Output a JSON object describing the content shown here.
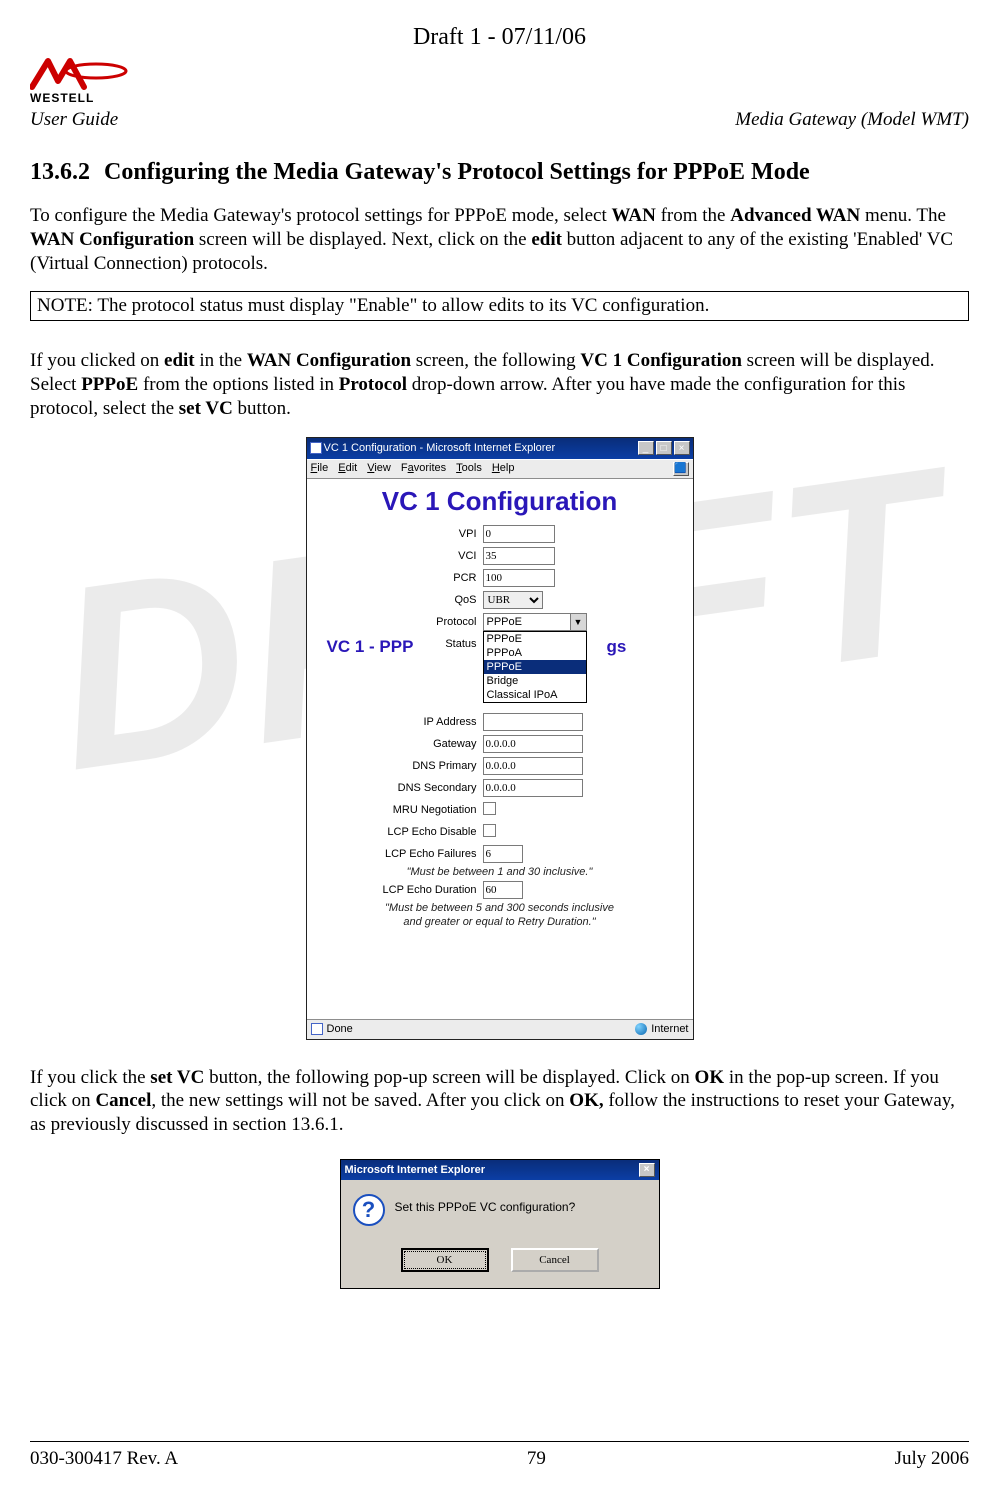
{
  "draft_header": "Draft 1 - 07/11/06",
  "logo_text": "WESTELL",
  "header": {
    "left": "User Guide",
    "right": "Media Gateway (Model WMT)"
  },
  "heading": {
    "number": "13.6.2",
    "title": "Configuring the Media Gateway's Protocol Settings for PPPoE Mode"
  },
  "para1": {
    "t1": "To configure the Media Gateway's protocol settings for PPPoE mode, select ",
    "b1": "WAN",
    "t2": " from the ",
    "b2": "Advanced WAN",
    "t3": " menu. The ",
    "b3": "WAN Configuration",
    "t4": " screen will be displayed. Next, click on the ",
    "b4": "edit",
    "t5": " button adjacent to any of the existing 'Enabled' VC (Virtual Connection) protocols."
  },
  "note": "NOTE: The protocol status must display \"Enable\" to allow edits to its VC configuration.",
  "para2": {
    "t1": "If you clicked on ",
    "b1": "edit",
    "t2": " in the ",
    "b2": "WAN Configuration",
    "t3": " screen, the following ",
    "b3": "VC 1 Configuration",
    "t4": " screen will be displayed. Select ",
    "b4": "PPPoE",
    "t5": " from the options listed in ",
    "b5": "Protocol",
    "t6": " drop-down arrow. After you have made the configuration for this protocol, select the ",
    "b6": "set VC",
    "t7": " button."
  },
  "ie": {
    "title": "VC 1 Configuration - Microsoft Internet Explorer",
    "menus": {
      "file": "File",
      "edit": "Edit",
      "view": "View",
      "favorites": "Favorites",
      "tools": "Tools",
      "help": "Help"
    },
    "heading": "VC 1 Configuration",
    "overlay_left": "VC 1 - PPP",
    "overlay_right": "gs",
    "labels": {
      "vpi": "VPI",
      "vci": "VCI",
      "pcr": "PCR",
      "qos": "QoS",
      "protocol": "Protocol",
      "status": "Status",
      "ip": "IP Address",
      "gw": "Gateway",
      "dns1": "DNS Primary",
      "dns2": "DNS Secondary",
      "mru": "MRU Negotiation",
      "lcpd": "LCP Echo Disable",
      "lcpf": "LCP Echo Failures",
      "lcpdur": "LCP Echo Duration"
    },
    "values": {
      "vpi": "0",
      "vci": "35",
      "pcr": "100",
      "qos": "UBR",
      "protocol_sel": "PPPoE",
      "gw": "0.0.0.0",
      "dns1": "0.0.0.0",
      "dns2": "0.0.0.0",
      "lcpf": "6",
      "lcpdur": "60"
    },
    "protocol_options": [
      "PPPoE",
      "PPPoA",
      "PPPoE",
      "Bridge",
      "Classical IPoA"
    ],
    "protocol_highlight_index": 2,
    "hint1": "\"Must be between 1 and 30 inclusive.\"",
    "hint2a": "\"Must be between 5 and 300 seconds inclusive",
    "hint2b": "and greater or equal to Retry Duration.\"",
    "status": {
      "left": "Done",
      "right": "Internet"
    }
  },
  "para3": {
    "t1": "If you click the ",
    "b1": "set VC",
    "t2": " button, the following pop-up screen will be displayed. Click on ",
    "b2": "OK",
    "t3": " in the pop-up screen. If you click on ",
    "b3": "Cancel",
    "t4": ", the new settings will not be saved. After you click on ",
    "b4": "OK,",
    "t5": " follow the instructions to reset your Gateway, as previously discussed in section 13.6.1."
  },
  "popup": {
    "title": "Microsoft Internet Explorer",
    "message": "Set this PPPoE VC configuration?",
    "ok": "OK",
    "cancel": "Cancel"
  },
  "footer": {
    "left": "030-300417 Rev. A",
    "center": "79",
    "right": "July 2006"
  },
  "watermark": "DRAFT"
}
